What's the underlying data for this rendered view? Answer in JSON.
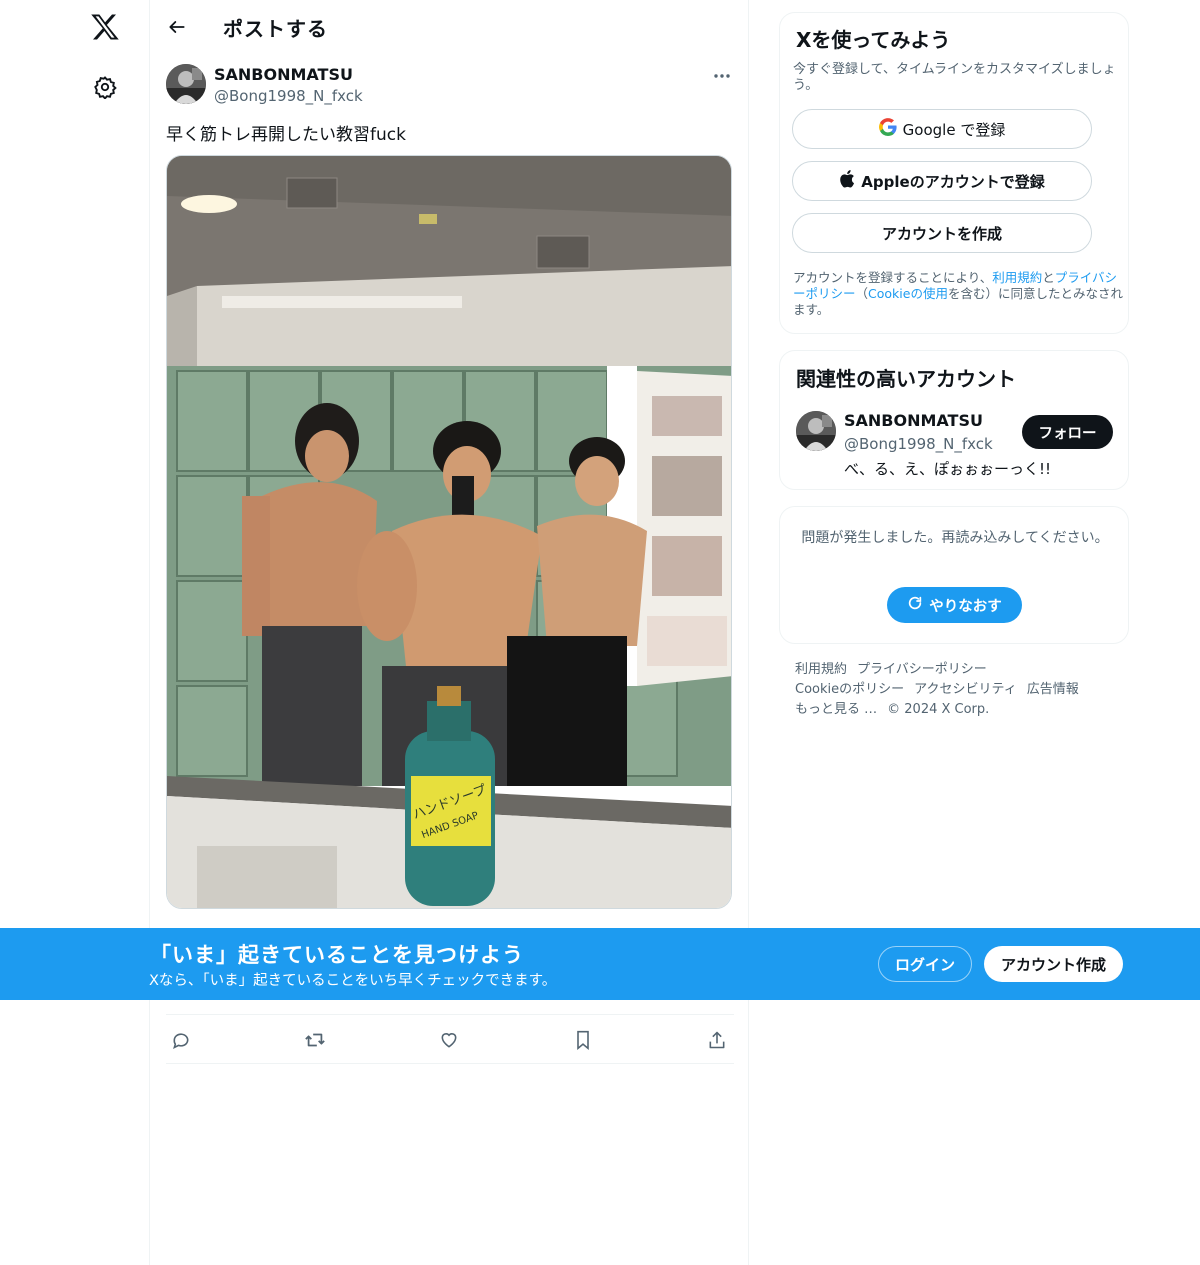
{
  "topbar": {
    "title": "ポストする"
  },
  "tweet": {
    "author_name": "SANBONMATSU",
    "author_handle": "@Bong1998_N_fxck",
    "text": "早く筋トレ再開したい教習fuck",
    "photo_bottle_label": "ハンドソープ",
    "photo_bottle_label_en": "HAND SOAP"
  },
  "signup": {
    "title": "Xを使ってみよう",
    "subtitle": "今すぐ登録して、タイムラインをカスタマイズしましょう。",
    "google_label": "Google で登録",
    "apple_label": "Appleのアカウントで登録",
    "create_label": "アカウントを作成",
    "terms_prefix": "アカウントを登録することにより、",
    "terms_link": "利用規約",
    "terms_and": "と",
    "privacy_link": "プライバシーポリシー",
    "terms_paren_open": "（",
    "cookie_link": "Cookieの使用",
    "terms_suffix": "を含む）に同意したとみなされます。"
  },
  "relevant": {
    "title": "関連性の高いアカウント",
    "name": "SANBONMATSU",
    "handle": "@Bong1998_N_fxck",
    "bio": "べ、る、え、ぽぉぉぉーっく!!",
    "follow_label": "フォロー"
  },
  "error": {
    "message": "問題が発生しました。再読み込みしてください。",
    "retry_label": "やりなおす"
  },
  "footer": {
    "links": [
      "利用規約",
      "プライバシーポリシー",
      "Cookieのポリシー",
      "アクセシビリティ",
      "広告情報",
      "もっと見る …"
    ],
    "copyright": "© 2024 X Corp."
  },
  "banner": {
    "headline": "「いま」起きていることを見つけよう",
    "subtitle": "Xなら、「いま」起きていることをいち早くチェックできます。",
    "login_label": "ログイン",
    "signup_label": "アカウント作成"
  },
  "colors": {
    "accent": "#1d9bf0",
    "text_primary": "#0f1419",
    "text_secondary": "#536471",
    "border": "#eff3f4"
  },
  "icons": {
    "logo": "x-logo-icon",
    "settings": "gear-icon",
    "back": "arrow-left-icon",
    "more": "more-dots-icon",
    "reply": "reply-icon",
    "repost": "repost-icon",
    "like": "heart-icon",
    "bookmark": "bookmark-icon",
    "share": "share-icon"
  }
}
